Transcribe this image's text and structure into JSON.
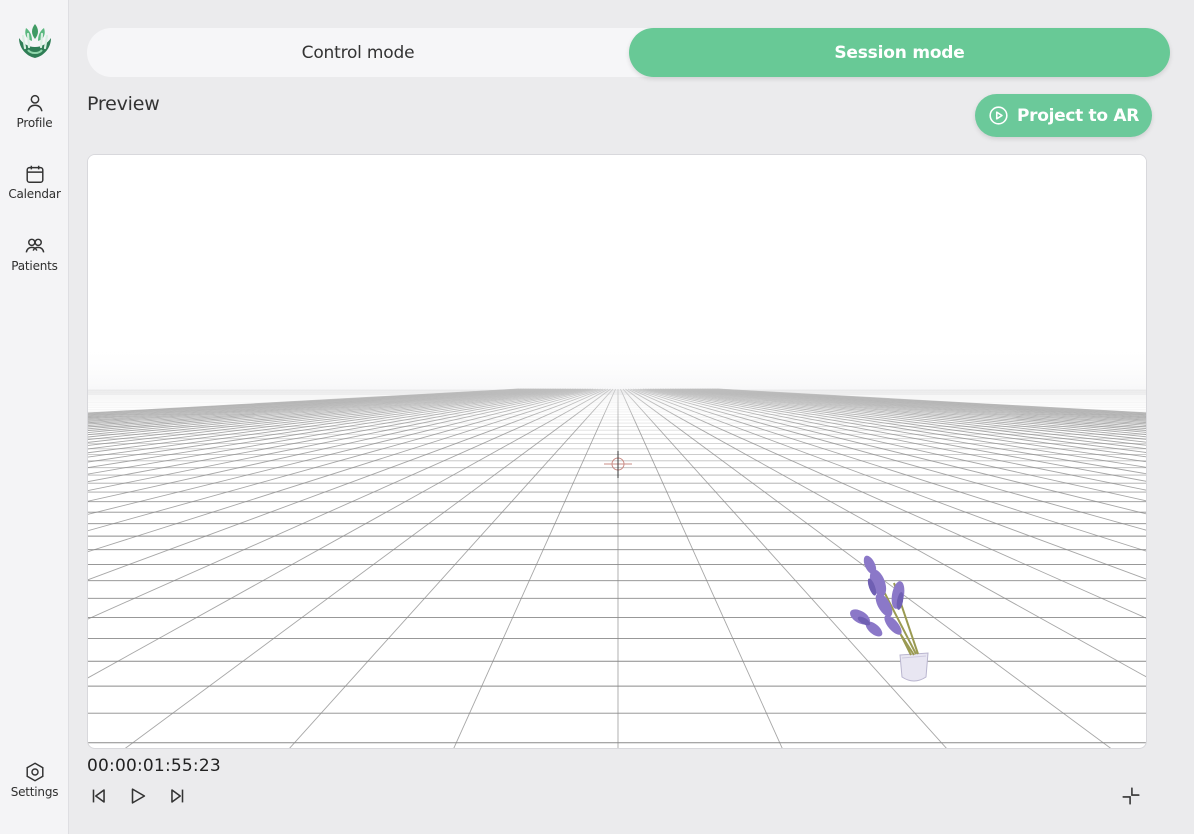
{
  "sidebar": {
    "logo": "hands-leaf-logo",
    "items": [
      {
        "label": "Profile",
        "icon": "user-icon"
      },
      {
        "label": "Calendar",
        "icon": "calendar-icon"
      },
      {
        "label": "Patients",
        "icon": "users-icon"
      }
    ],
    "settings": {
      "label": "Settings",
      "icon": "hexagon-gear-icon"
    }
  },
  "mode_toggle": {
    "control_label": "Control mode",
    "session_label": "Session mode",
    "active": "Session mode"
  },
  "preview": {
    "title": "Preview",
    "project_button_label": "Project to AR",
    "project_button_icon": "play-circle-icon"
  },
  "player": {
    "timecode": "00:00:01:55:23",
    "controls": [
      "skip-back-icon",
      "play-icon",
      "skip-forward-icon"
    ],
    "minimize_icon": "minimize-icon"
  },
  "colors": {
    "accent": "#68c996",
    "sidebar_bg": "#f4f4f6",
    "page_bg": "#ebebed"
  }
}
